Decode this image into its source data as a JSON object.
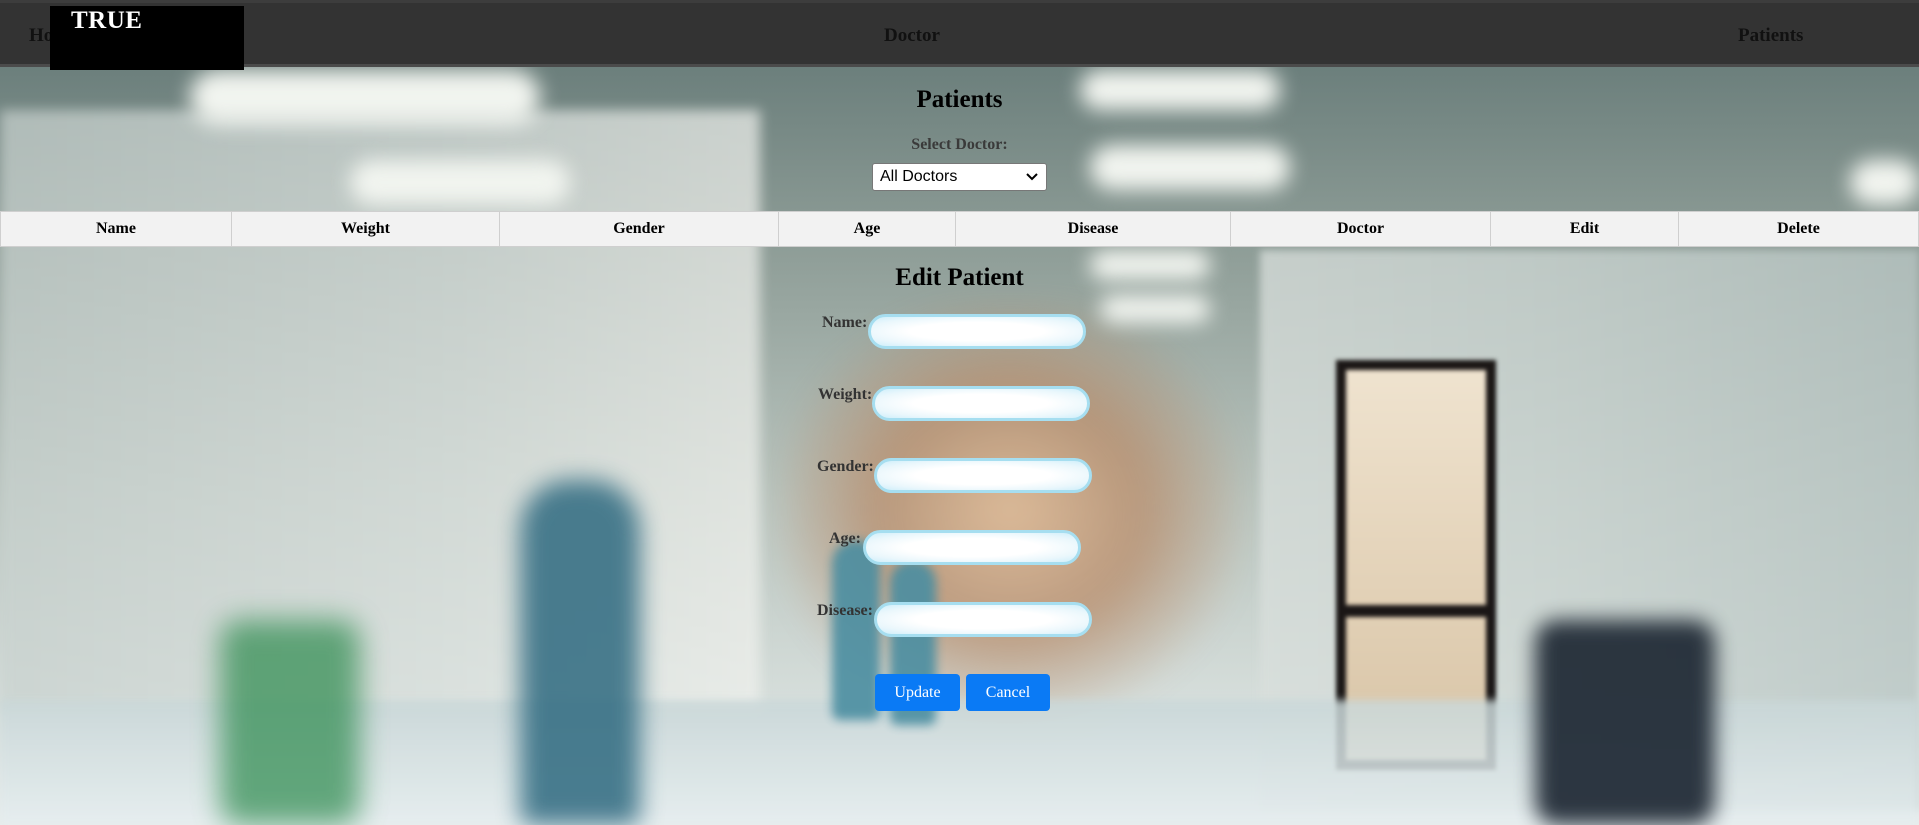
{
  "navbar": {
    "brand": "TRUE",
    "home_label": "Home",
    "doctor_label": "Doctor",
    "patients_label": "Patients"
  },
  "patients_section": {
    "title": "Patients",
    "select_label": "Select Doctor:",
    "select_value": "All Doctors"
  },
  "table": {
    "columns": [
      "Name",
      "Weight",
      "Gender",
      "Age",
      "Disease",
      "Doctor",
      "Edit",
      "Delete"
    ]
  },
  "edit_form": {
    "title": "Edit Patient",
    "fields": [
      {
        "label": "Name:",
        "value": ""
      },
      {
        "label": "Weight:",
        "value": ""
      },
      {
        "label": "Gender:",
        "value": ""
      },
      {
        "label": "Age:",
        "value": ""
      },
      {
        "label": "Disease:",
        "value": ""
      }
    ],
    "update_label": "Update",
    "cancel_label": "Cancel"
  },
  "colors": {
    "navbar": "#333333",
    "brand_bg": "#000000",
    "button": "#0a7af5",
    "input_border": "#a6def0"
  }
}
